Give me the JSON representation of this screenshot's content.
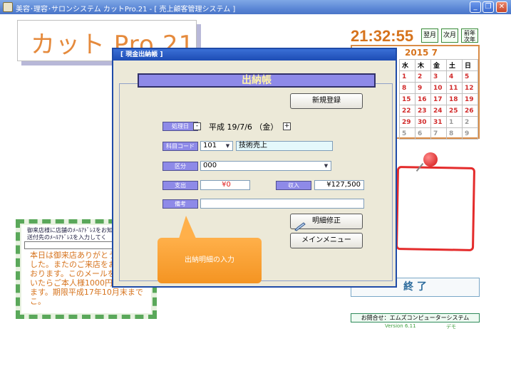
{
  "window": {
    "title": "美容･理容･サロンシステム カットPro.21 - [ 売上顧客管理システム ]",
    "minimize_glyph": "_",
    "restore_glyph": "❐",
    "close_glyph": "✕"
  },
  "background": {
    "logo_text": "カット Pro.21",
    "clock": "21:32:55",
    "next_month_label": "翌月",
    "prev_month_label": "次月",
    "prev_year_label": "前年",
    "next_year_label": "次年",
    "calendar": {
      "header": "2015 7",
      "weekdays": [
        "水",
        "木",
        "金",
        "土",
        "日"
      ],
      "rows": [
        [
          "1",
          "2",
          "3",
          "4",
          "5"
        ],
        [
          "8",
          "9",
          "10",
          "11",
          "12"
        ],
        [
          "15",
          "16",
          "17",
          "18",
          "19"
        ],
        [
          "22",
          "23",
          "24",
          "25",
          "26"
        ],
        [
          "29",
          "30",
          "31",
          "1",
          "2"
        ],
        [
          "5",
          "6",
          "7",
          "8",
          "9"
        ]
      ]
    },
    "end_button_label": "終 了",
    "contact": "お問合せ：エムズコンピューターシステム",
    "version": "Version 6.11",
    "demo_label": "デモ",
    "ticket": {
      "header_line1": "御来店様に店舗のﾒｰﾙｱﾄﾞﾚｽをお知ら",
      "header_line2": "送付先のﾒｰﾙｱﾄﾞﾚｽを入力してく",
      "body": "本日は御来店ありがとうございました。またのご来店をお待ちしております。このメールをお見せ頂いたらご本人様1000円引きいたします。期限平成17年10月末までこ。"
    }
  },
  "dialog": {
    "title": "[ 現金出納帳 ]",
    "banner": "出納帳",
    "new_entry_button": "新規登録",
    "date": {
      "label": "処理日",
      "value": "平成 19/7/6 （金）",
      "minus": "-",
      "plus": "+"
    },
    "account_code": {
      "label": "科目コード",
      "code": "101",
      "name": "技術売上"
    },
    "category": {
      "label": "区分",
      "value": "000"
    },
    "expense": {
      "label": "支出",
      "value": "¥0"
    },
    "income": {
      "label": "収入",
      "value": "¥127,500"
    },
    "memo": {
      "label": "備考",
      "value": ""
    },
    "edit_detail_button": "明細修正",
    "main_menu_button": "メインメニュー",
    "tooltip": "出納明細の入力"
  }
}
